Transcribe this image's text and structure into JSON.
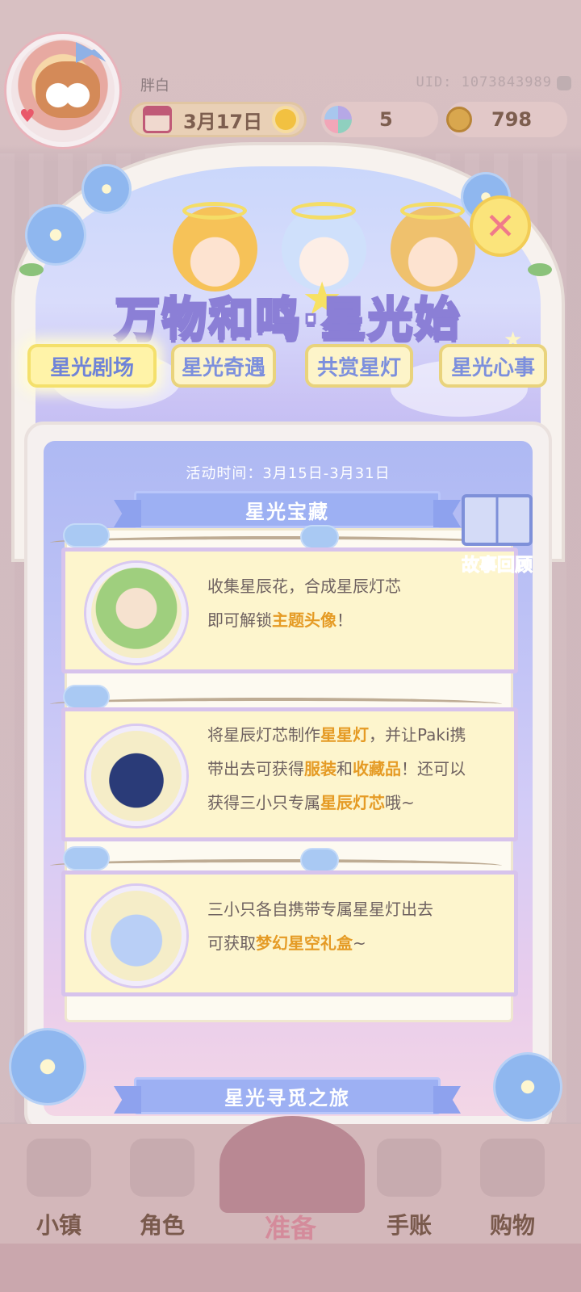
{
  "player": {
    "name": "胖白",
    "uid": "UID: 1073843989"
  },
  "currency": {
    "date": "3月17日",
    "star_count": "5",
    "coins": "798"
  },
  "banner": {
    "title": "万物和鸣·星光始"
  },
  "tabs": [
    {
      "label": "星光剧场",
      "active": true
    },
    {
      "label": "星光奇遇",
      "active": false
    },
    {
      "label": "共赏星灯",
      "active": false
    },
    {
      "label": "星光心事",
      "active": false
    }
  ],
  "event": {
    "time": "活动时间：3月15日-3月31日",
    "section_title": "星光宝藏",
    "story_review": "故事回顾",
    "entries": [
      {
        "icon": "goddess-portrait-icon",
        "line1": "收集星辰花，合成星辰灯芯",
        "line2_prefix": "即可解锁",
        "line2_hl": "主题头像",
        "line2_suffix": "！"
      },
      {
        "icon": "starry-dress-icon",
        "p1": "将星辰灯芯制作",
        "h1": "星星灯",
        "p2": "，并让Paki携",
        "p3": "带出去可获得",
        "h2": "服装",
        "p4": "和",
        "h3": "收藏品",
        "p5": "！还可以",
        "p6": "获得三小只专属",
        "h4": "星辰灯芯",
        "p7": "哦~"
      },
      {
        "icon": "dreamy-gift-box-icon",
        "line1": "三小只各自携带专属星星灯出去",
        "line2_prefix": "可获取",
        "line2_hl": "梦幻星空礼盒",
        "line2_suffix": "~"
      }
    ],
    "journey_title": "星光寻觅之旅"
  },
  "nav": [
    {
      "label": "小镇",
      "icon": "map-icon"
    },
    {
      "label": "角色",
      "icon": "character-icon"
    },
    {
      "label": "准备",
      "icon": "prepare-icon"
    },
    {
      "label": "手账",
      "icon": "journal-icon"
    },
    {
      "label": "购物",
      "icon": "shopping-bag-icon"
    }
  ],
  "colors": {
    "accent_blue": "#7c8fdd",
    "highlight": "#e59b25",
    "tab_bg": "#fdf4c9",
    "entry_border": "#d7c3ec"
  }
}
